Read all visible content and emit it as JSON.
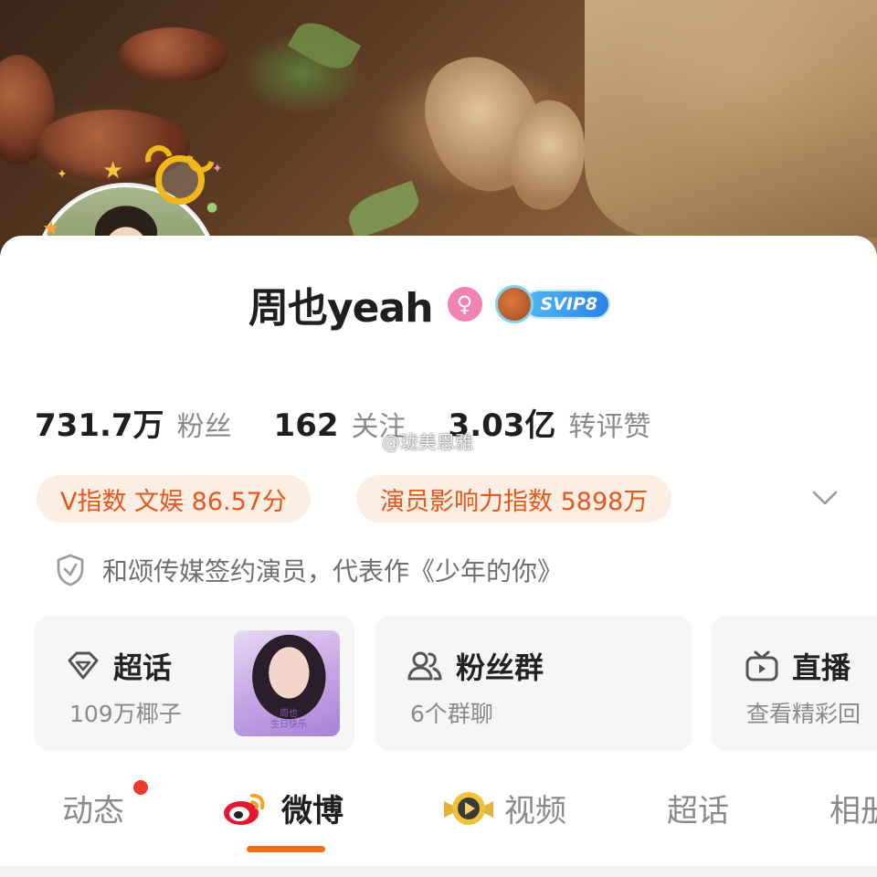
{
  "profile": {
    "name": "周也yeah",
    "gender_symbol": "♀",
    "vip_label": "SVIP8"
  },
  "stats": [
    {
      "value": "731.7万",
      "label": "粉丝"
    },
    {
      "value": "162",
      "label": "关注"
    },
    {
      "value": "3.03亿",
      "label": "转评赞"
    }
  ],
  "watermark": "@珑美恩雅",
  "chips": [
    {
      "label": "V指数 文娱 86.57分"
    },
    {
      "label": "演员影响力指数 5898万"
    }
  ],
  "verification": "和颂传媒签约演员，代表作《少年的你》",
  "features": [
    {
      "title": "超话",
      "subtitle": "109万椰子",
      "icon": "diamond-icon"
    },
    {
      "title": "粉丝群",
      "subtitle": "6个群聊",
      "icon": "people-icon"
    },
    {
      "title": "直播",
      "subtitle": "查看精彩回",
      "icon": "tv-icon"
    }
  ],
  "poster_caption": "周也\n生日快乐",
  "tabs": [
    {
      "label": "动态",
      "active": false
    },
    {
      "label": "微博",
      "active": true
    },
    {
      "label": "视频",
      "active": false
    },
    {
      "label": "超话",
      "active": false
    },
    {
      "label": "相册",
      "active": false
    }
  ],
  "colors": {
    "accent_orange": "#f06e15",
    "chip_bg": "#fdeee4",
    "chip_text": "#e4571e",
    "gender_pink": "#f083b4",
    "notification_red": "#f03a2e"
  }
}
